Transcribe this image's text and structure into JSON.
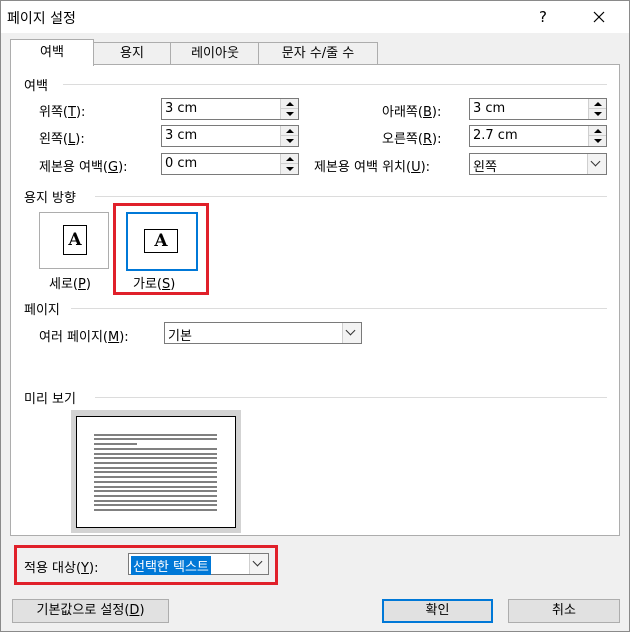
{
  "window": {
    "title": "페이지 설정",
    "help": "?",
    "close": "✕"
  },
  "tabs": [
    {
      "label": "여백",
      "active": true
    },
    {
      "label": "용지",
      "active": false
    },
    {
      "label": "레이아웃",
      "active": false
    },
    {
      "label": "문자 수/줄 수",
      "active": false
    }
  ],
  "margins": {
    "group_title": "여백",
    "top": {
      "label": "위쪽(",
      "key": "T",
      "suffix": "):",
      "value": "3 cm"
    },
    "bottom": {
      "label": "아래쪽(",
      "key": "B",
      "suffix": "):",
      "value": "3 cm"
    },
    "left": {
      "label": "왼쪽(",
      "key": "L",
      "suffix": "):",
      "value": "3 cm"
    },
    "right": {
      "label": "오른쪽(",
      "key": "R",
      "suffix": "):",
      "value": "2.7 cm"
    },
    "gutter": {
      "label": "제본용 여백(",
      "key": "G",
      "suffix": "):",
      "value": "0 cm"
    },
    "gutter_position": {
      "label": "제본용 여백 위치(",
      "key": "U",
      "suffix": "):",
      "value": "왼쪽"
    }
  },
  "orientation": {
    "group_title": "용지 방향",
    "portrait": {
      "label": "세로(",
      "key": "P",
      "suffix": ")",
      "glyph": "A",
      "selected": false
    },
    "landscape": {
      "label": "가로(",
      "key": "S",
      "suffix": ")",
      "glyph": "A",
      "selected": true
    }
  },
  "pages": {
    "group_title": "페이지",
    "multiple": {
      "label": "여러 페이지(",
      "key": "M",
      "suffix": "):",
      "value": "기본"
    }
  },
  "preview": {
    "group_title": "미리 보기"
  },
  "apply_to": {
    "label": "적용 대상(",
    "key": "Y",
    "suffix": "):",
    "value": "선택한 텍스트"
  },
  "buttons": {
    "set_default": {
      "label": "기본값으로 설정(",
      "key": "D",
      "suffix": ")"
    },
    "ok": "확인",
    "cancel": "취소"
  },
  "colors": {
    "highlight": "#e0202a",
    "accent": "#0078d7",
    "selection": "#0078d7"
  }
}
